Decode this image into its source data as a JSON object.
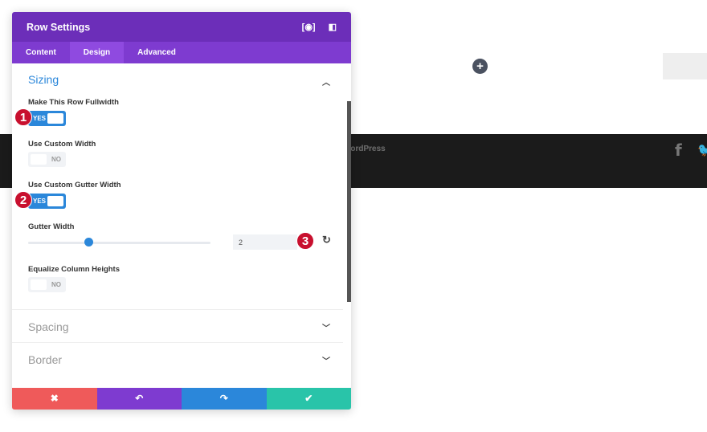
{
  "page": {
    "footer_text": "WordPress",
    "footer_visible_text": "ordPress",
    "facebook": "f",
    "twitter": "🐦",
    "add_button": "+"
  },
  "modal": {
    "title": "Row Settings",
    "header_icons": [
      "fullscreen-icon",
      "sidebar-icon"
    ],
    "tabs": [
      {
        "label": "Content"
      },
      {
        "label": "Design",
        "active": true
      },
      {
        "label": "Advanced"
      }
    ],
    "sizing": {
      "title": "Sizing",
      "fullwidth": {
        "label": "Make This Row Fullwidth",
        "value": "YES",
        "on": true
      },
      "custom_width": {
        "label": "Use Custom Width",
        "value": "NO",
        "on": false
      },
      "custom_gutter": {
        "label": "Use Custom Gutter Width",
        "value": "YES",
        "on": true
      },
      "gutter_width": {
        "label": "Gutter Width",
        "value": "2",
        "min": 1,
        "max": 4
      },
      "equalize": {
        "label": "Equalize Column Heights",
        "value": "NO",
        "on": false
      }
    },
    "sections": [
      {
        "title": "Spacing"
      },
      {
        "title": "Border"
      }
    ],
    "badges": [
      "1",
      "2",
      "3"
    ],
    "actions": {
      "cancel": "✖",
      "undo": "↶",
      "redo": "↷",
      "save": "✔"
    },
    "colors": {
      "header": "#6c2eb9",
      "tabs": "#7e3bd0",
      "accent": "#2b87da",
      "cancel": "#ef5a5a",
      "undo": "#7e3bd0",
      "redo": "#2b87da",
      "save": "#29c4a9",
      "badge": "#c8102e"
    }
  }
}
